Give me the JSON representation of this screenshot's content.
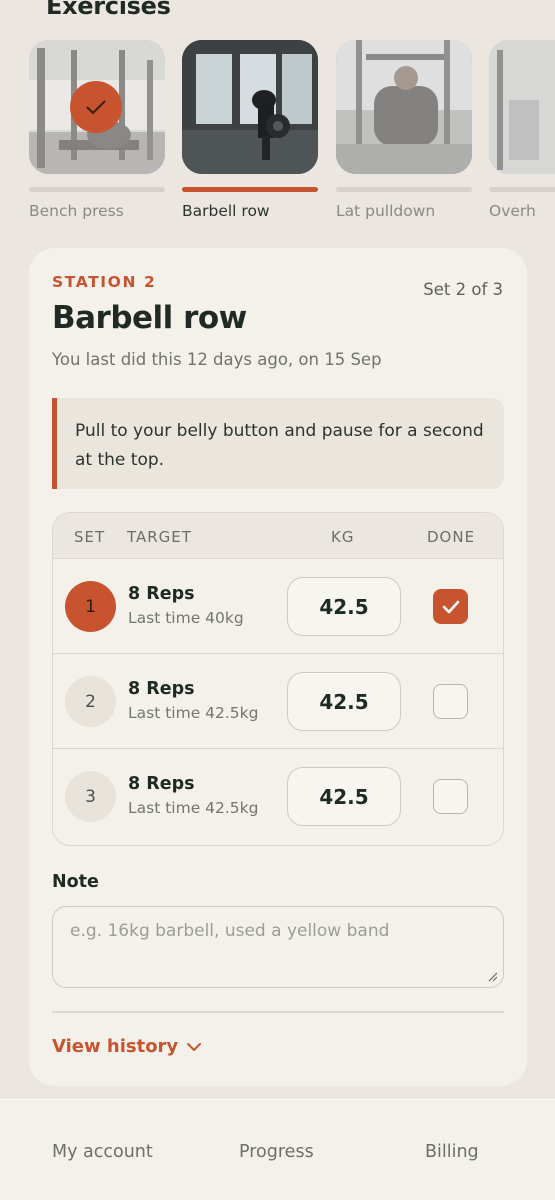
{
  "section": {
    "title": "Exercises"
  },
  "exercises": [
    {
      "label": "Bench press",
      "completed": true,
      "active": false
    },
    {
      "label": "Barbell row",
      "completed": false,
      "active": true
    },
    {
      "label": "Lat pulldown",
      "completed": false,
      "active": false
    },
    {
      "label": "Overh",
      "completed": false,
      "active": false
    }
  ],
  "station": {
    "label": "STATION 2",
    "set_progress": "Set 2 of 3",
    "title": "Barbell row",
    "last_did": "You last did this 12 days ago, on 15 Sep",
    "tip": "Pull to your belly button and pause for a second at the top."
  },
  "table": {
    "headers": {
      "set": "SET",
      "target": "TARGET",
      "kg": "KG",
      "done": "DONE"
    },
    "rows": [
      {
        "num": "1",
        "reps": "8 Reps",
        "last": "Last time 40kg",
        "kg": "42.5",
        "done": true,
        "current": true
      },
      {
        "num": "2",
        "reps": "8 Reps",
        "last": "Last time 42.5kg",
        "kg": "42.5",
        "done": false,
        "current": false
      },
      {
        "num": "3",
        "reps": "8 Reps",
        "last": "Last time 42.5kg",
        "kg": "42.5",
        "done": false,
        "current": false
      }
    ]
  },
  "note": {
    "label": "Note",
    "placeholder": "e.g. 16kg barbell, used a yellow band",
    "value": ""
  },
  "history": {
    "label": "View history"
  },
  "nav": {
    "account": "My account",
    "progress": "Progress",
    "billing": "Billing"
  },
  "colors": {
    "accent": "#c8542f",
    "background": "#ebe7e0",
    "card": "#f4f1ea",
    "text": "#1f2a24"
  },
  "icons": {
    "completed": "check-icon",
    "history_toggle": "chevron-down-icon",
    "done_checked": "check-icon"
  }
}
